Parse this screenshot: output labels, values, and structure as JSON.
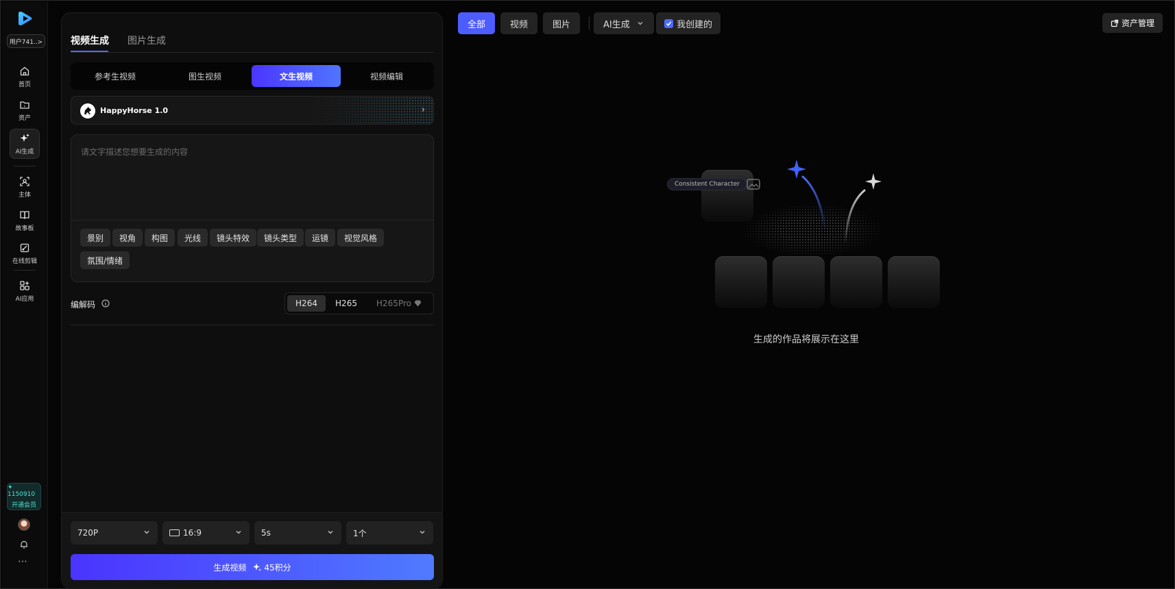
{
  "rail": {
    "user": "用户741..>",
    "items": [
      {
        "label": "首页",
        "icon": "home-icon"
      },
      {
        "label": "资产",
        "icon": "folder-icon"
      },
      {
        "label": "AI生成",
        "icon": "sparkle-icon",
        "active": true
      },
      {
        "label": "主体",
        "icon": "subject-scan-icon"
      },
      {
        "label": "故事板",
        "icon": "book-icon"
      },
      {
        "label": "在线剪辑",
        "icon": "edit-icon"
      },
      {
        "label": "AI应用",
        "icon": "apps-icon"
      }
    ],
    "credits": "✦ 1150910",
    "vip": "开通会员",
    "more": "⋯"
  },
  "panel": {
    "main_tabs": [
      {
        "label": "视频生成",
        "active": true
      },
      {
        "label": "图片生成",
        "active": false
      }
    ],
    "mode_tabs": [
      {
        "label": "参考生视频",
        "active": false
      },
      {
        "label": "图生视频",
        "active": false
      },
      {
        "label": "文生视频",
        "active": true
      },
      {
        "label": "视频编辑",
        "active": false
      }
    ],
    "model": {
      "name": "HappyHorse 1.0",
      "chevron": "›"
    },
    "prompt": {
      "placeholder": "请文字描述您想要生成的内容",
      "value": ""
    },
    "chips": [
      "景别",
      "视角",
      "构图",
      "光线",
      "镜头特效",
      "镜头类型",
      "运镜",
      "视觉风格",
      "氛围/情绪"
    ],
    "codec": {
      "label": "编解码",
      "options": [
        {
          "label": "H264",
          "active": true
        },
        {
          "label": "H265",
          "active": false
        },
        {
          "label": "H265Pro",
          "active": false,
          "premium": true
        }
      ]
    },
    "selects": {
      "resolution": "720P",
      "ratio": "16:9",
      "duration": "5s",
      "count": "1个"
    },
    "generate": {
      "label": "生成视频",
      "cost": "45积分"
    }
  },
  "filters": {
    "all": "全部",
    "video": "视频",
    "image": "图片",
    "ai_gen": "AI生成",
    "mine": "我创建的",
    "mine_checked": true
  },
  "asset_manage": "资产管理",
  "empty": {
    "badge": "Consistent Character",
    "message": "生成的作品将展示在这里"
  },
  "colors": {
    "accent": "#4d5cff",
    "gradient_start": "#4a34ff",
    "gradient_end": "#4f7bff",
    "credits": "#53e0d0"
  }
}
